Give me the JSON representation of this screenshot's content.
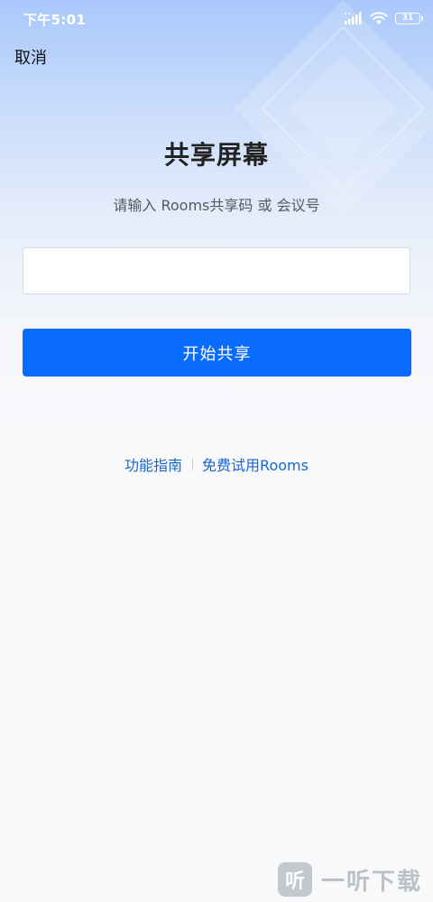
{
  "status_bar": {
    "time": "下午5:01",
    "battery": "31"
  },
  "header": {
    "cancel_label": "取消"
  },
  "main": {
    "title": "共享屏幕",
    "subtitle": "请输入 Rooms共享码 或 会议号",
    "code_input": {
      "value": "",
      "placeholder": ""
    },
    "start_button_label": "开始共享"
  },
  "footer_links": {
    "guide_label": "功能指南",
    "trial_label": "免费试用Rooms"
  },
  "watermark": {
    "logo_char": "听",
    "text": "一听下载"
  },
  "colors": {
    "primary": "#0a6cff",
    "link": "#1a66d1",
    "title_text": "#222222"
  }
}
